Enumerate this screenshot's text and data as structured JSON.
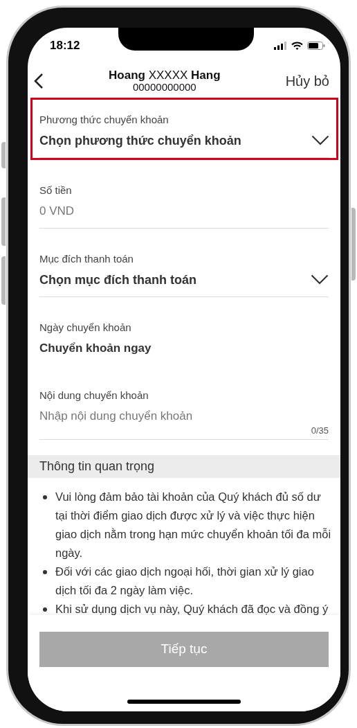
{
  "status_bar": {
    "time": "18:12"
  },
  "header": {
    "title": "**Hoang** XXXXX **Hang**",
    "account": "00000000000",
    "cancel": "Hủy bỏ"
  },
  "fields": [
    {
      "kind": "select",
      "label": "Phương thức chuyển khoản",
      "value": "Chọn phương thức chuyển khoản",
      "highlighted": true
    },
    {
      "kind": "text",
      "label": "Số tiền",
      "placeholder": "0 VND",
      "highlighted": false
    },
    {
      "kind": "select",
      "label": "Mục đích thanh toán",
      "value": "Chọn mục đích thanh toán",
      "highlighted": false
    },
    {
      "kind": "static",
      "label": "Ngày chuyển khoản",
      "value": "Chuyển khoản ngay",
      "highlighted": false
    },
    {
      "kind": "textarea",
      "label": "Nội dung chuyển khoản",
      "placeholder": "Nhập nội dung chuyển khoản",
      "counter": "0/35",
      "highlighted": false
    }
  ],
  "important_info": {
    "title": "Thông tin quan trọng",
    "items": [
      "Vui lòng đảm bảo tài khoản của Quý khách đủ số dư tại thời điểm giao dịch được xử lý và việc thực hiện giao dịch nằm trong hạn mức chuyển khoản tối đa mỗi ngày.",
      "Đối với các giao dịch ngoại hối, thời gian xử lý giao dịch tối đa 2 ngày làm việc.",
      "Khi sử dụng dịch vụ này, Quý khách đã đọc và đồng ý"
    ]
  },
  "continue_button": {
    "label": "Tiếp tục",
    "disabled": true
  }
}
